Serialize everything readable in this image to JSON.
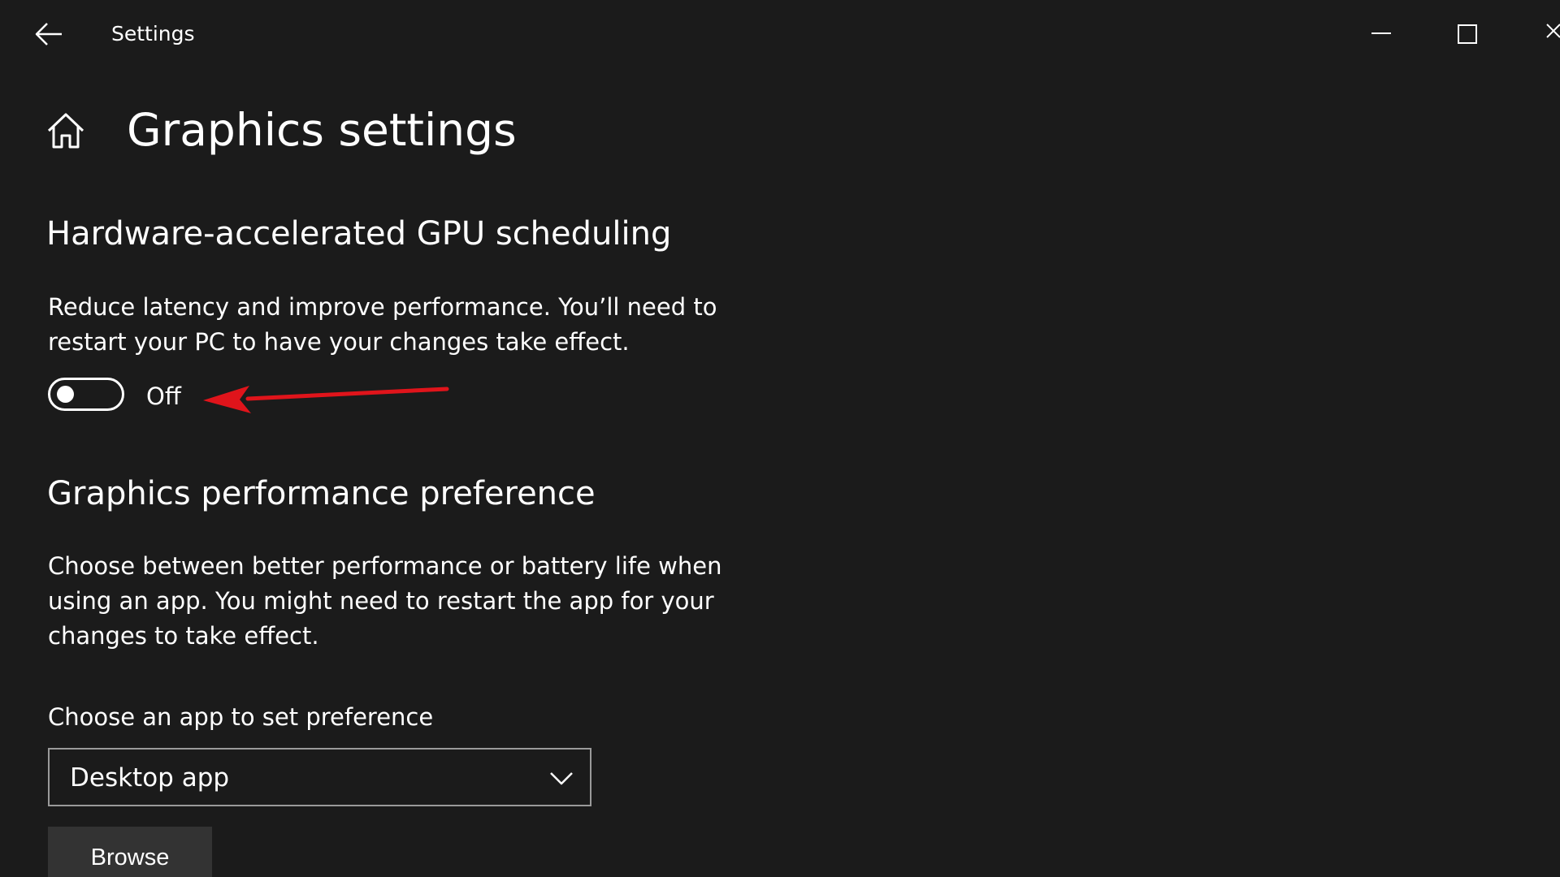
{
  "titlebar": {
    "app_title": "Settings",
    "back_icon": "back-arrow-icon",
    "minimize_icon": "minimize-icon",
    "maximize_icon": "maximize-icon",
    "close_icon": "close-icon"
  },
  "page": {
    "home_icon": "home-icon",
    "title": "Graphics settings"
  },
  "gpu_scheduling": {
    "title": "Hardware-accelerated GPU scheduling",
    "description": "Reduce latency and improve performance. You’ll need to restart your PC to have your changes take effect.",
    "toggle_on": false,
    "toggle_state_label": "Off",
    "annotation": "red-arrow-icon"
  },
  "performance_preference": {
    "title": "Graphics performance preference",
    "description": "Choose between better performance or battery life when using an app. You might need to restart the app for your changes to take effect.",
    "select_label": "Choose an app to set preference",
    "selected_app_type": "Desktop app",
    "browse_label": "Browse"
  },
  "colors": {
    "background": "#1b1b1b",
    "text": "#ffffff",
    "annotation": "#e0141b",
    "button": "#333333"
  }
}
